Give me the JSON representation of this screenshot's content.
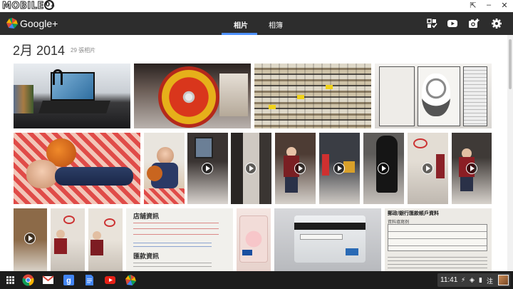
{
  "watermark": {
    "text": "MOBILE",
    "suffix": "01"
  },
  "window_controls": [
    "⇱",
    "–",
    "✕"
  ],
  "header": {
    "brand": "Google+",
    "tabs": [
      {
        "label": "相片",
        "active": true
      },
      {
        "label": "相簿",
        "active": false
      }
    ],
    "icons": [
      "gallery-select-icon",
      "youtube-icon",
      "camera-upload-icon",
      "settings-icon"
    ]
  },
  "album": {
    "title": "2月 2014",
    "count": "29 張相片"
  },
  "photos": [
    {
      "name": "photo-laptop-desk",
      "video": false
    },
    {
      "name": "photo-cd-disc",
      "video": false
    },
    {
      "name": "photo-store-shelves",
      "video": false
    },
    {
      "name": "photo-manga-page",
      "video": false
    },
    {
      "name": "photo-child-basketball-bed",
      "video": false
    },
    {
      "name": "photo-child-ball-sitting",
      "video": false
    },
    {
      "name": "video-doorway",
      "video": true
    },
    {
      "name": "video-corridor",
      "video": true
    },
    {
      "name": "video-child-walking",
      "video": true
    },
    {
      "name": "video-child-toys",
      "video": true
    },
    {
      "name": "video-dark-figure",
      "video": true
    },
    {
      "name": "video-child-hoop",
      "video": true
    },
    {
      "name": "video-child-door",
      "video": true
    },
    {
      "name": "video-child-cabinet",
      "video": true
    },
    {
      "name": "photo-child-hoop-1",
      "video": false
    },
    {
      "name": "photo-child-hoop-2",
      "video": false
    },
    {
      "name": "photo-store-document",
      "video": false
    },
    {
      "name": "photo-card-front",
      "video": false
    },
    {
      "name": "photo-card-back",
      "video": false
    },
    {
      "name": "photo-remittance-form",
      "video": false
    }
  ],
  "photo_text": {
    "store_doc_title": "店舖資訊",
    "store_doc_sub": "匯款資訊",
    "form_title": "郵政/銀行匯款帳戶資料",
    "form_sub": "資料填寫例"
  },
  "taskbar": {
    "apps": [
      "app-launcher-icon",
      "chrome-icon",
      "gmail-icon",
      "google-search-icon",
      "docs-icon",
      "youtube-icon",
      "photos-icon"
    ],
    "clock": "11:41",
    "tray_symbols": [
      "⚡",
      "◈",
      "▮",
      "注"
    ]
  }
}
